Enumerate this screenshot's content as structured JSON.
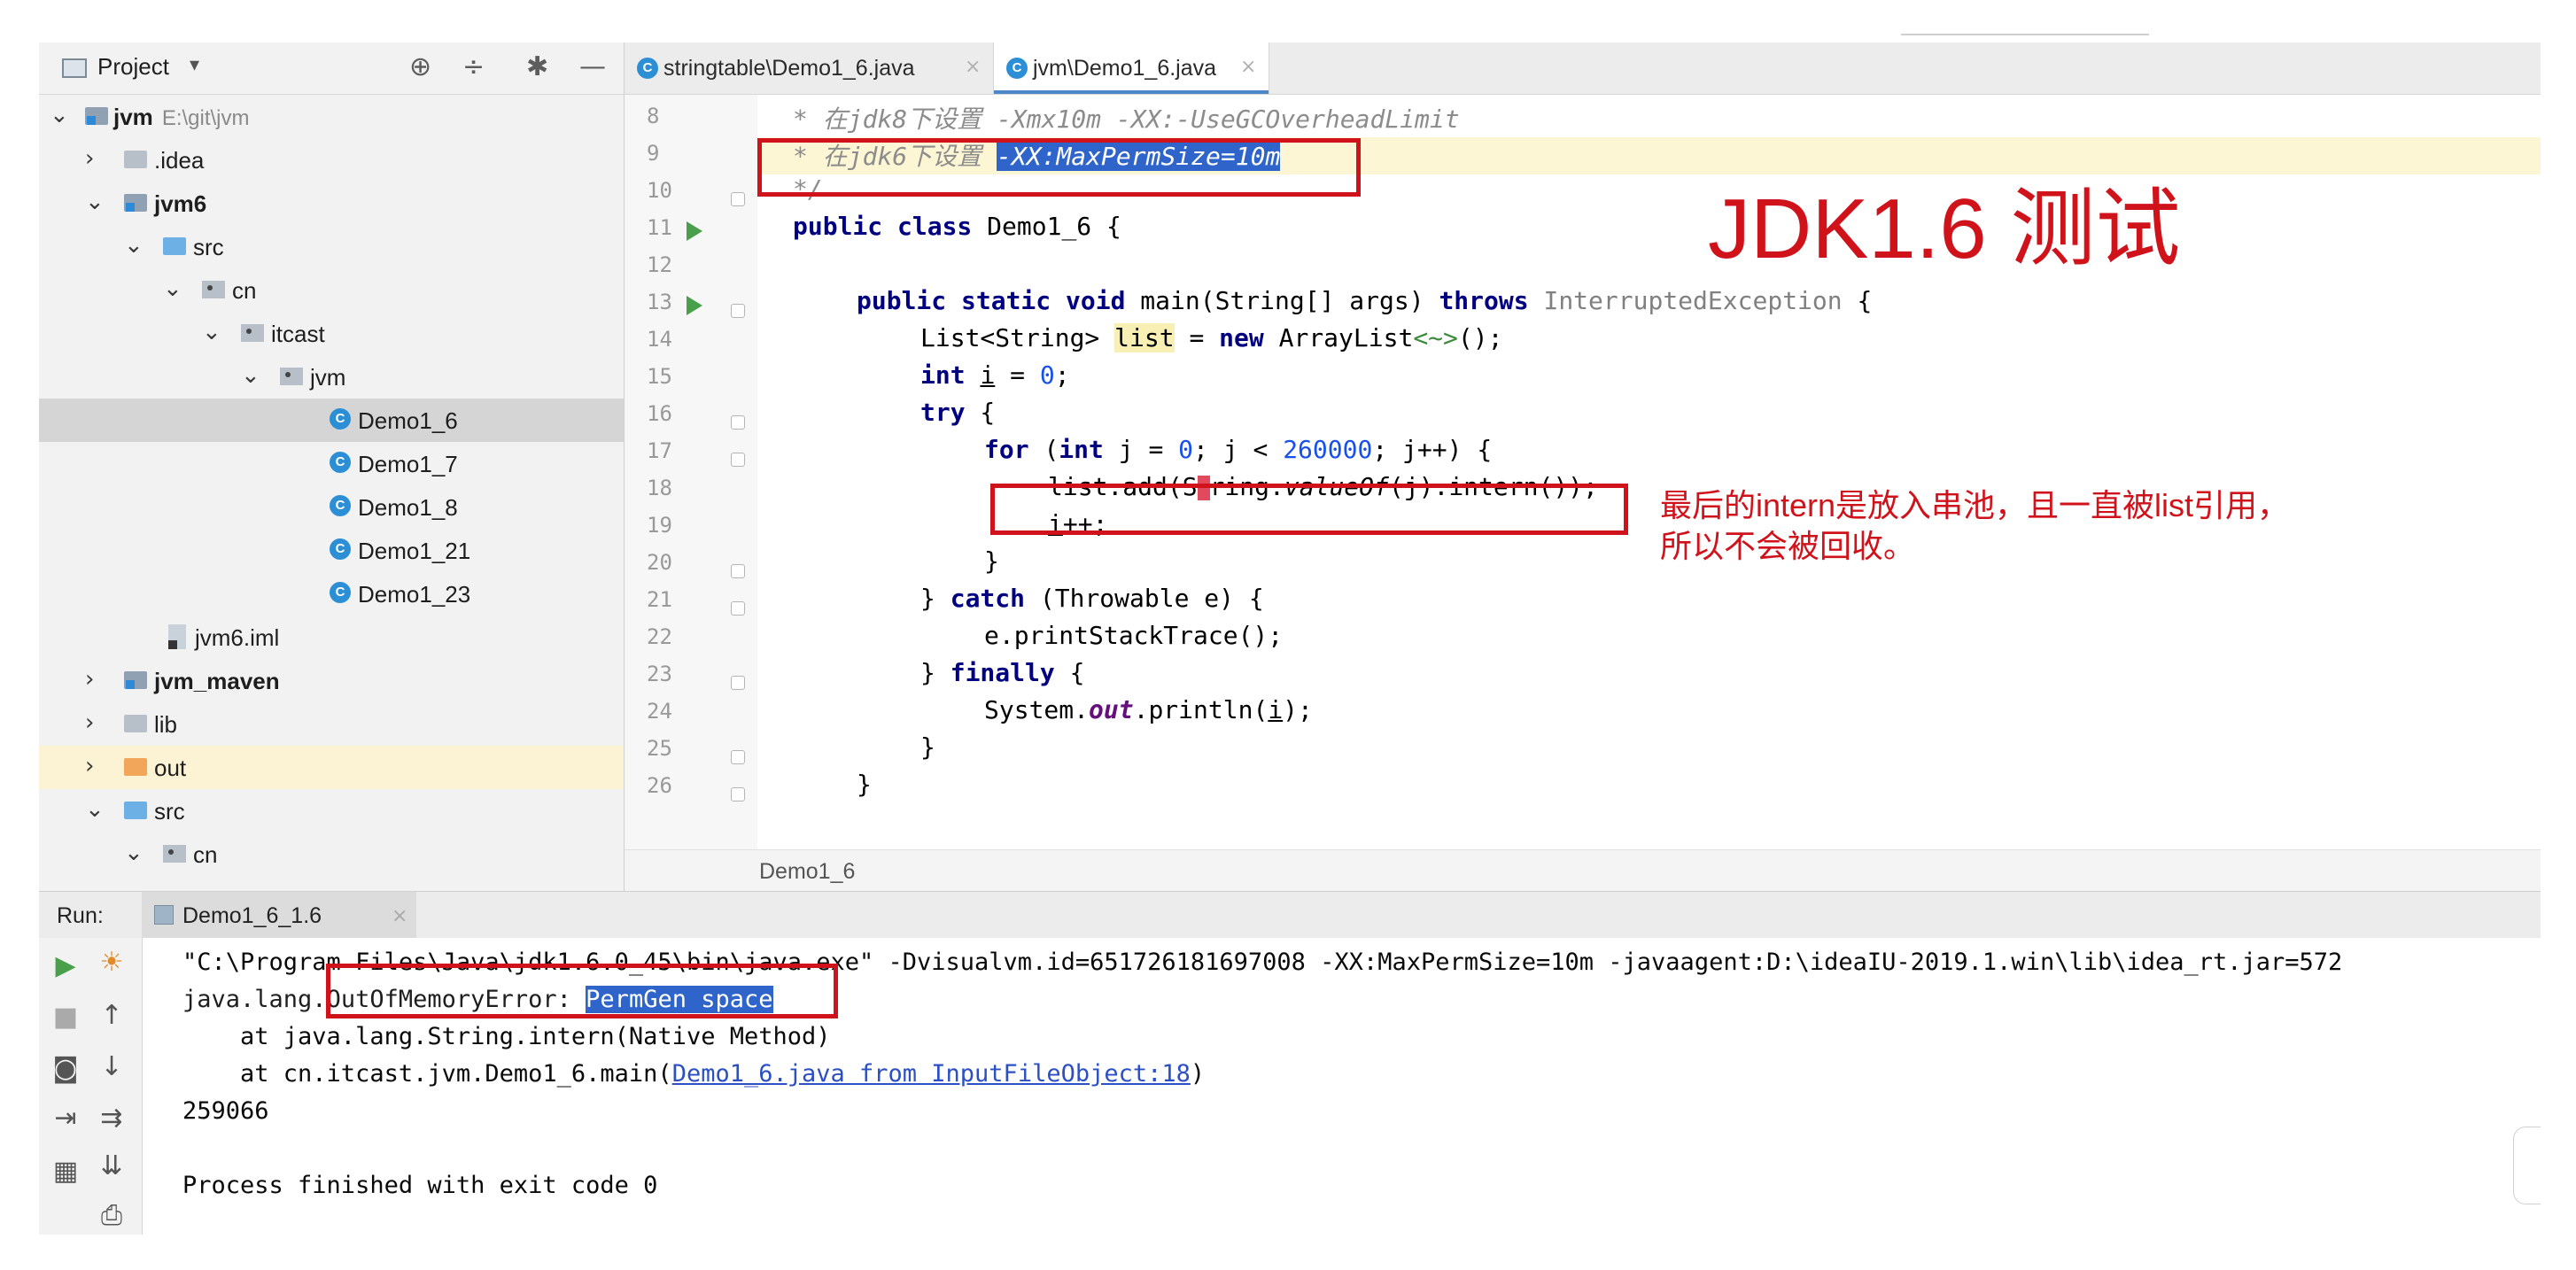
{
  "project_panel": {
    "title": "Project",
    "dropdown": "▾",
    "header_icons": [
      "crosshair-icon",
      "collapse-icon",
      "gear-icon",
      "minimize-icon"
    ],
    "tree": [
      {
        "label": "jvm",
        "path": "E:\\git\\jvm",
        "bold": true,
        "icon": "module-folder",
        "expanded": true
      },
      {
        "label": ".idea",
        "icon": "folder",
        "expanded": false
      },
      {
        "label": "jvm6",
        "bold": true,
        "icon": "module-folder",
        "expanded": true
      },
      {
        "label": "src",
        "icon": "source-folder",
        "expanded": true
      },
      {
        "label": "cn",
        "icon": "package",
        "expanded": true
      },
      {
        "label": "itcast",
        "icon": "package",
        "expanded": true
      },
      {
        "label": "jvm",
        "icon": "package",
        "expanded": true
      },
      {
        "label": "Demo1_6",
        "icon": "class",
        "selected": true
      },
      {
        "label": "Demo1_7",
        "icon": "class"
      },
      {
        "label": "Demo1_8",
        "icon": "class"
      },
      {
        "label": "Demo1_21",
        "icon": "class"
      },
      {
        "label": "Demo1_23",
        "icon": "class"
      },
      {
        "label": "jvm6.iml",
        "icon": "iml-file"
      },
      {
        "label": "jvm_maven",
        "bold": true,
        "icon": "module-folder",
        "expanded": false
      },
      {
        "label": "lib",
        "icon": "folder",
        "expanded": false
      },
      {
        "label": "out",
        "icon": "excluded-folder",
        "expanded": false,
        "highlight": true
      },
      {
        "label": "src",
        "icon": "source-folder",
        "expanded": true
      },
      {
        "label": "cn",
        "icon": "package",
        "expanded": true
      }
    ]
  },
  "editor_tabs": [
    {
      "label": "stringtable\\Demo1_6.java",
      "close": "×",
      "active": false
    },
    {
      "label": "jvm\\Demo1_6.java",
      "close": "×",
      "active": true
    }
  ],
  "code_lines": [
    {
      "no": "8"
    },
    {
      "no": "9"
    },
    {
      "no": "10"
    },
    {
      "no": "11"
    },
    {
      "no": "12"
    },
    {
      "no": "13"
    },
    {
      "no": "14"
    },
    {
      "no": "15"
    },
    {
      "no": "16"
    },
    {
      "no": "17"
    },
    {
      "no": "18"
    },
    {
      "no": "19"
    },
    {
      "no": "20"
    },
    {
      "no": "21"
    },
    {
      "no": "22"
    },
    {
      "no": "23"
    },
    {
      "no": "24"
    },
    {
      "no": "25"
    },
    {
      "no": "26"
    }
  ],
  "code_text": {
    "l8": "* 在jdk8下设置 -Xmx10m -XX:-UseGCOverheadLimit",
    "l9_prefix": "* 在jdk6下设置 ",
    "l9_selected": "-XX:MaxPermSize=10m",
    "l10": "*/",
    "l11_kw": "public class ",
    "l11_rest": "Demo1_6 {",
    "l13_kw1": "public static void ",
    "l13_mid": "main(String[] args) ",
    "l13_kw2": "throws ",
    "l13_exc": "InterruptedException",
    "l13_end": " {",
    "l14_a": "List<String> ",
    "l14_var": "list",
    "l14_b": " = ",
    "l14_kw": "new ",
    "l14_c": "ArrayList",
    "l14_d": "<~>",
    "l14_e": "();",
    "l15_kw": "int ",
    "l15_var": "i",
    "l15_b": " = ",
    "l15_num": "0",
    "l15_e": ";",
    "l16_kw": "try",
    "l16_e": " {",
    "l17_kw1": "for ",
    "l17_a": "(",
    "l17_kw2": "int ",
    "l17_b": "j = ",
    "l17_n1": "0",
    "l17_c": "; j < ",
    "l17_n2": "260000",
    "l17_d": "; j++) {",
    "l18_a": "list.add(S",
    "l18_b": "ring.",
    "l18_it": "valueOf",
    "l18_c": "(j).intern());",
    "l19_var": "i",
    "l19_e": "++;",
    "l20": "}",
    "l21_a": "} ",
    "l21_kw": "catch ",
    "l21_b": "(Throwable e) {",
    "l22": "e.printStackTrace();",
    "l23_a": "} ",
    "l23_kw": "finally ",
    "l23_b": "{",
    "l24_a": "System.",
    "l24_it": "out",
    "l24_b": ".println(",
    "l24_var": "i",
    "l24_c": ");",
    "l25": "}",
    "l26": "}"
  },
  "breadcrumb": "Demo1_6",
  "run_panel": {
    "label": "Run:",
    "tab": "Demo1_6_1.6",
    "tab_close": "×",
    "console": {
      "line1": "\"C:\\Program Files\\Java\\jdk1.6.0_45\\bin\\java.exe\" -Dvisualvm.id=651726181697008 -XX:MaxPermSize=10m -javaagent:D:\\ideaIU-2019.1.win\\lib\\idea_rt.jar=572",
      "line2_a": "java.lang.",
      "line2_b": "OutOfMemoryError: ",
      "line2_sel": "PermGen space",
      "line3": "    at java.lang.String.intern(Native Method)",
      "line4_a": "    at cn.itcast.jvm.Demo1_6.main(",
      "line4_link": "Demo1_6.java from InputFileObject:18",
      "line4_b": ")",
      "line5": "259066",
      "line6": "Process finished with exit code 0"
    }
  },
  "annotations": {
    "title": "JDK1.6 测试",
    "note_line1": "最后的intern是放入串池，且一直被list引用，",
    "note_line2": "所以不会被回收。",
    "color": "#d0121b"
  },
  "colors": {
    "keyword": "#000080",
    "number": "#1750eb",
    "comment": "#8c8c8c",
    "selection": "#2f65ca",
    "link": "#2b4fc4"
  }
}
